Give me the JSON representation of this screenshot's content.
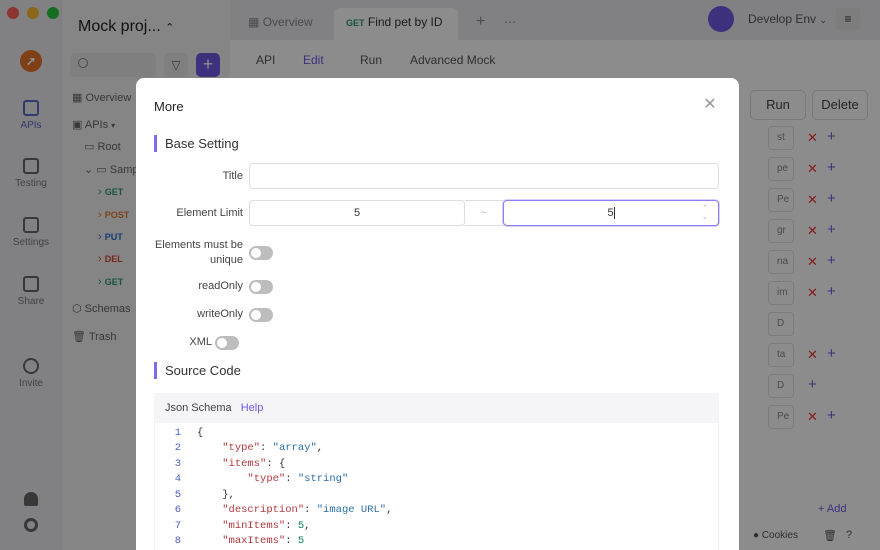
{
  "window": {
    "traffic_lights": [
      "#ff5f57",
      "#febc2e",
      "#28c840"
    ]
  },
  "rail": {
    "items": [
      {
        "label": "APIs",
        "icon": "api-icon"
      },
      {
        "label": "Testing",
        "icon": "testing-icon"
      },
      {
        "label": "Settings",
        "icon": "settings-icon"
      },
      {
        "label": "Share",
        "icon": "share-icon"
      },
      {
        "label": "Invite",
        "icon": "invite-icon"
      }
    ]
  },
  "sidebar": {
    "project_title": "Mock proj...",
    "tree": [
      {
        "label": "Overview"
      },
      {
        "label": "APIs"
      },
      {
        "label": "Root"
      },
      {
        "label": "Samp"
      },
      {
        "method": "GET",
        "label": ""
      },
      {
        "method": "POST",
        "label": ""
      },
      {
        "method": "PUT",
        "label": ""
      },
      {
        "method": "DEL",
        "label": ""
      },
      {
        "method": "GET",
        "label": ""
      },
      {
        "label": "Schemas"
      },
      {
        "label": "Trash"
      }
    ]
  },
  "topbar": {
    "tab_overview": "Overview",
    "tab_active_method": "GET",
    "tab_active_label": "Find pet by ID",
    "env": "Develop Env"
  },
  "content": {
    "subtabs": [
      "API",
      "Edit",
      "Run",
      "Advanced Mock"
    ],
    "run_button": "Run",
    "delete_button": "Delete",
    "rows": [
      "st",
      "pe",
      "Pe",
      "gr",
      "na",
      "im",
      "D",
      "ta",
      "D",
      "Pe"
    ],
    "add_label": "+ Add",
    "cookies": "Cookies"
  },
  "dialog": {
    "title": "More",
    "base_section": "Base Setting",
    "title_label": "Title",
    "title_value": "",
    "element_limit_label": "Element Limit",
    "min_value": "5",
    "range_separator": "~",
    "max_value": "5",
    "unique_label": "Elements must be unique",
    "readonly_label": "readOnly",
    "writeonly_label": "writeOnly",
    "xml_label": "XML",
    "source_section": "Source Code",
    "code_tab": "Json Schema",
    "help_link": "Help",
    "code_lines": [
      {
        "n": "1",
        "text": "{"
      },
      {
        "n": "2",
        "key": "\"type\"",
        "val": "\"array\"",
        "tail": ","
      },
      {
        "n": "3",
        "key": "\"items\"",
        "open": "{"
      },
      {
        "n": "4",
        "key": "\"type\"",
        "val": "\"string\"",
        "tail": ""
      },
      {
        "n": "5",
        "text": "},"
      },
      {
        "n": "6",
        "key": "\"description\"",
        "val": "\"image URL\"",
        "tail": ","
      },
      {
        "n": "7",
        "key": "\"minItems\"",
        "num": "5",
        "tail": ","
      },
      {
        "n": "8",
        "key": "\"maxItems\"",
        "num": "5",
        "tail": ""
      }
    ]
  }
}
